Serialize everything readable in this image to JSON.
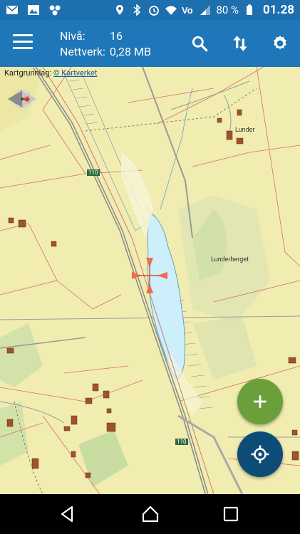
{
  "statusbar": {
    "battery": "80 %",
    "clock": "01.28",
    "icons": [
      "mail-icon",
      "image-icon",
      "dots-icon",
      "location-icon",
      "bluetooth-icon",
      "alarm-icon",
      "wifi-icon",
      "volte-icon",
      "signal-icon",
      "battery-icon"
    ]
  },
  "header": {
    "level_label": "Nivå:",
    "level_value": "16",
    "network_label": "Nettverk:",
    "network_value": "0,28 MB"
  },
  "map": {
    "attribution_prefix": "Kartgrunnlag:",
    "attribution_link": "© Kartverket",
    "places": {
      "lunder": "Lunder",
      "lunderberget": "Lunderberget",
      "road_110_a": "110",
      "road_110_b": "110"
    }
  },
  "colors": {
    "statusbar": "#1e6fae",
    "appbar": "#1f76b8",
    "fab_add": "#6a9f3a",
    "fab_locate": "#0e4c78",
    "water": "#cdeefb",
    "land": "#f1edb0"
  }
}
